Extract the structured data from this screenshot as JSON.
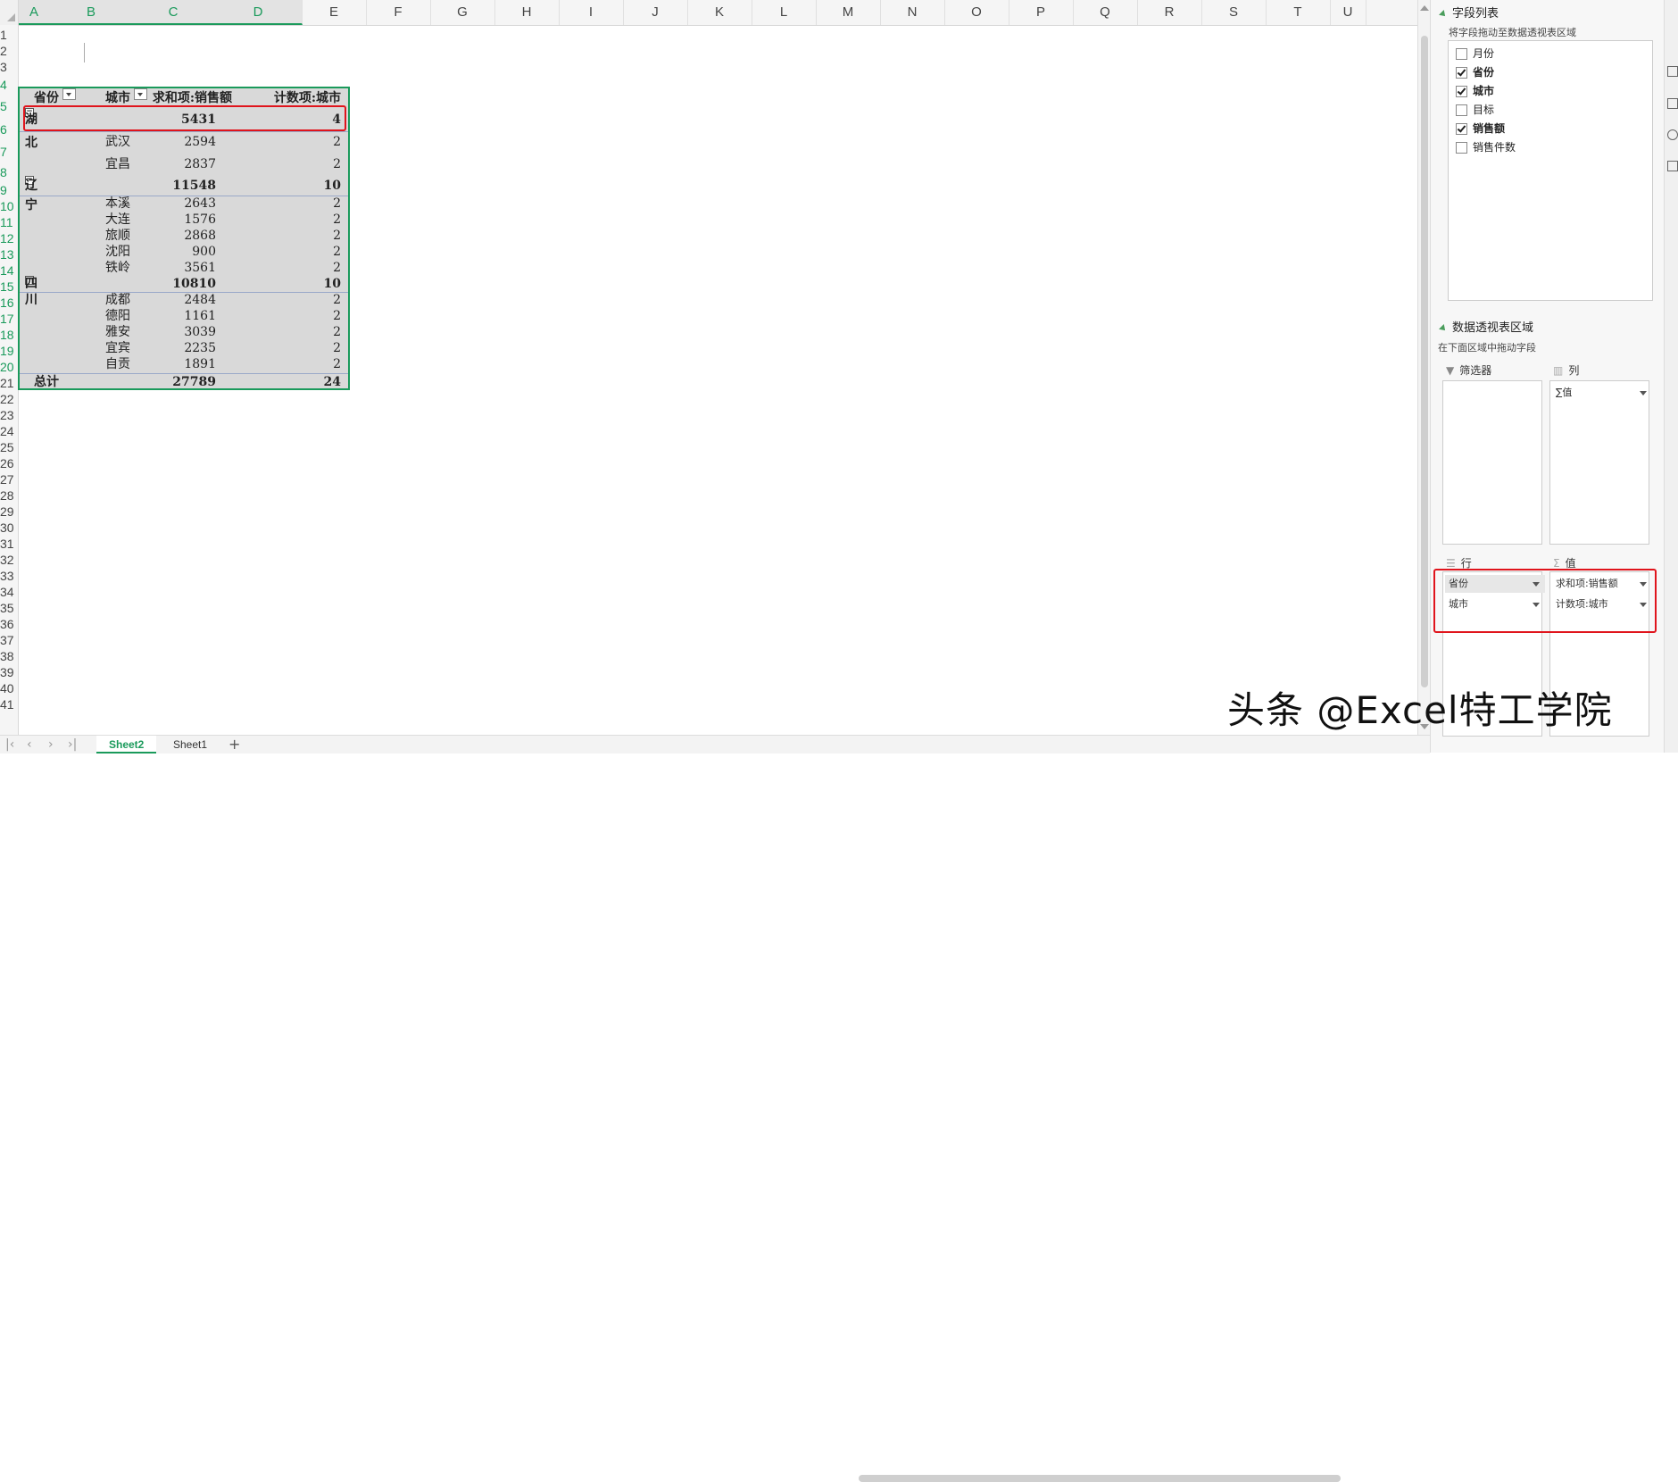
{
  "columns": [
    "A",
    "B",
    "C",
    "D",
    "E",
    "F",
    "G",
    "H",
    "I",
    "J",
    "K",
    "L",
    "M",
    "N",
    "O",
    "P",
    "Q",
    "R",
    "S",
    "T",
    "U"
  ],
  "rows": [
    "1",
    "2",
    "3",
    "4",
    "5",
    "6",
    "7",
    "8",
    "9",
    "10",
    "11",
    "12",
    "13",
    "14",
    "15",
    "16",
    "17",
    "18",
    "19",
    "20",
    "21",
    "22",
    "23",
    "24",
    "25",
    "26",
    "27",
    "28",
    "29",
    "30",
    "31",
    "32",
    "33",
    "34",
    "35",
    "36",
    "37",
    "38",
    "39",
    "40",
    "41"
  ],
  "pivot": {
    "headers": {
      "province": "省份",
      "city": "城市",
      "sum": "求和项:销售额",
      "count": "计数项:城市"
    },
    "groups": [
      {
        "name": "湖北",
        "sum": "5431",
        "count": "4",
        "cities": [
          {
            "name": "武汉",
            "sum": "2594",
            "count": "2"
          },
          {
            "name": "宜昌",
            "sum": "2837",
            "count": "2"
          }
        ]
      },
      {
        "name": "辽宁",
        "sum": "11548",
        "count": "10",
        "cities": [
          {
            "name": "本溪",
            "sum": "2643",
            "count": "2"
          },
          {
            "name": "大连",
            "sum": "1576",
            "count": "2"
          },
          {
            "name": "旅顺",
            "sum": "2868",
            "count": "2"
          },
          {
            "name": "沈阳",
            "sum": "900",
            "count": "2"
          },
          {
            "name": "铁岭",
            "sum": "3561",
            "count": "2"
          }
        ]
      },
      {
        "name": "四川",
        "sum": "10810",
        "count": "10",
        "cities": [
          {
            "name": "成都",
            "sum": "2484",
            "count": "2"
          },
          {
            "name": "德阳",
            "sum": "1161",
            "count": "2"
          },
          {
            "name": "雅安",
            "sum": "3039",
            "count": "2"
          },
          {
            "name": "宜宾",
            "sum": "2235",
            "count": "2"
          },
          {
            "name": "自贡",
            "sum": "1891",
            "count": "2"
          }
        ]
      }
    ],
    "total": {
      "label": "总计",
      "sum": "27789",
      "count": "24"
    }
  },
  "tabs": [
    {
      "label": "Sheet2",
      "active": true
    },
    {
      "label": "Sheet1",
      "active": false
    }
  ],
  "add_sheet": "+",
  "panel": {
    "field_list_title": "字段列表",
    "field_list_hint": "将字段拖动至数据透视表区域",
    "fields": [
      {
        "label": "月份",
        "checked": false
      },
      {
        "label": "省份",
        "checked": true
      },
      {
        "label": "城市",
        "checked": true
      },
      {
        "label": "目标",
        "checked": false
      },
      {
        "label": "销售额",
        "checked": true
      },
      {
        "label": "销售件数",
        "checked": false
      }
    ],
    "areas_title": "数据透视表区域",
    "areas_hint": "在下面区域中拖动字段",
    "filter_label": "筛选器",
    "column_label": "列",
    "column_items": [
      "∑值"
    ],
    "row_label": "行",
    "row_items": [
      "省份",
      "城市"
    ],
    "value_label": "值",
    "value_items": [
      "求和项:销售额",
      "计数项:城市"
    ]
  },
  "watermark": "头条 @Excel特工学院",
  "colors": {
    "accent": "#1a9a5b",
    "highlight": "#e0141c",
    "pivot_fill": "#d9d9d9"
  }
}
